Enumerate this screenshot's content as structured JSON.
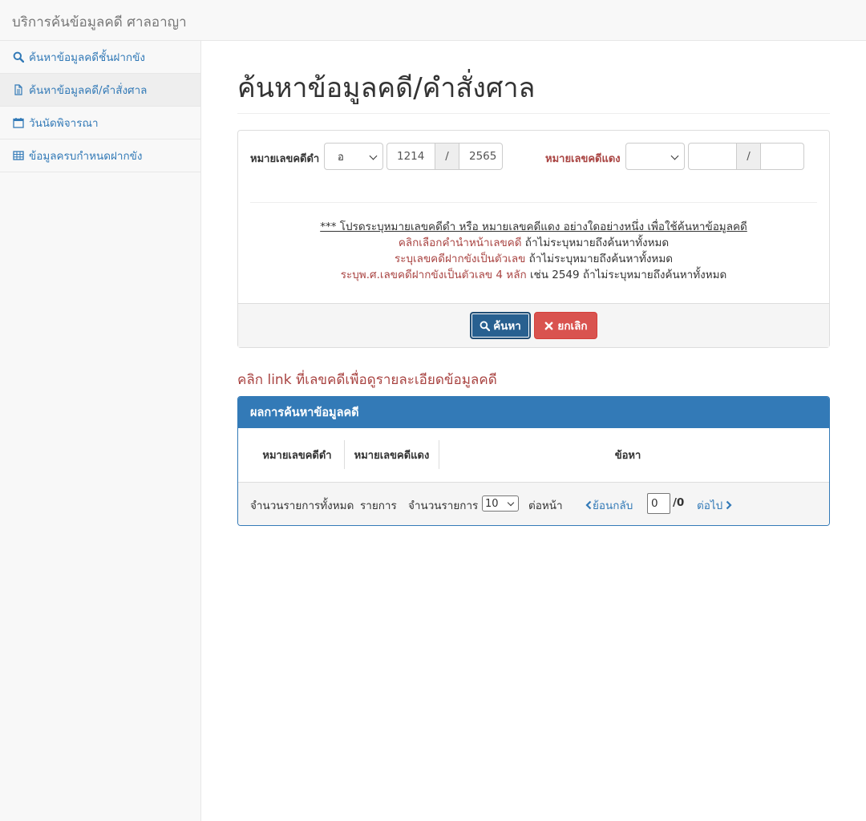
{
  "navbar": {
    "brand": "บริการค้นข้อมูลคดี ศาลอาญา"
  },
  "sidebar": {
    "items": [
      {
        "label": "ค้นหาข้อมูลคดีชั้นฝากขัง",
        "icon": "search-icon"
      },
      {
        "label": "ค้นหาข้อมูลคดี/คำสั่งศาล",
        "icon": "file-icon"
      },
      {
        "label": "วันนัดพิจารณา",
        "icon": "calendar-icon"
      },
      {
        "label": "ข้อมูลครบกำหนดฝากขัง",
        "icon": "table-icon"
      }
    ]
  },
  "page": {
    "title": "ค้นหาข้อมูลคดี/คำสั่งศาล"
  },
  "form": {
    "black_label": "หมายเลขคดีดำ",
    "black_prefix": "อ",
    "black_number": "1214",
    "black_sep": "/",
    "black_year": "2565",
    "red_label": "หมายเลขคดีแดง",
    "red_prefix": "",
    "red_number": "",
    "red_sep": "/",
    "red_year": ""
  },
  "notes": {
    "line1": "*** โปรดระบุหมายเลขคดีดำ หรือ หมายเลขคดีแดง อย่างใดอย่างหนึ่ง เพื่อใช้ค้นหาข้อมูลคดี",
    "line2_red": "คลิกเลือกคำนำหน้าเลขคดี",
    "line2_rest": " ถ้าไม่ระบุหมายถึงค้นหาทั้งหมด",
    "line3_red": "ระบุเลขคดีฝากขังเป็นตัวเลข",
    "line3_rest": " ถ้าไม่ระบุหมายถึงค้นหาทั้งหมด",
    "line4_red": "ระบุพ.ศ.เลขคดีฝากขังเป็นตัวเลข 4 หลัก",
    "line4_rest": " เช่น 2549 ถ้าไม่ระบุหมายถึงค้นหาทั้งหมด"
  },
  "buttons": {
    "search": "ค้นหา",
    "cancel": "ยกเลิก"
  },
  "hint": "คลิก link ที่เลขคดีเพื่อดูรายละเอียดข้อมูลคดี",
  "results": {
    "heading": "ผลการค้นหาข้อมูลคดี",
    "columns": [
      "หมายเลขคดีดำ",
      "หมายเลขคดีแดง",
      "ข้อหา"
    ]
  },
  "pager": {
    "total_label": "จำนวนรายการทั้งหมด",
    "items_label": "รายการ",
    "per_page_label": "จำนวนรายการ",
    "per_page_value": "10",
    "per_page_suffix": "ต่อหน้า",
    "prev": "ย้อนกลับ",
    "page_value": "0",
    "page_total": "/0",
    "next": "ต่อไป"
  },
  "colors": {
    "link": "#337ab7",
    "danger": "#d9534f",
    "primary": "#286090",
    "red_text": "#a94442"
  }
}
